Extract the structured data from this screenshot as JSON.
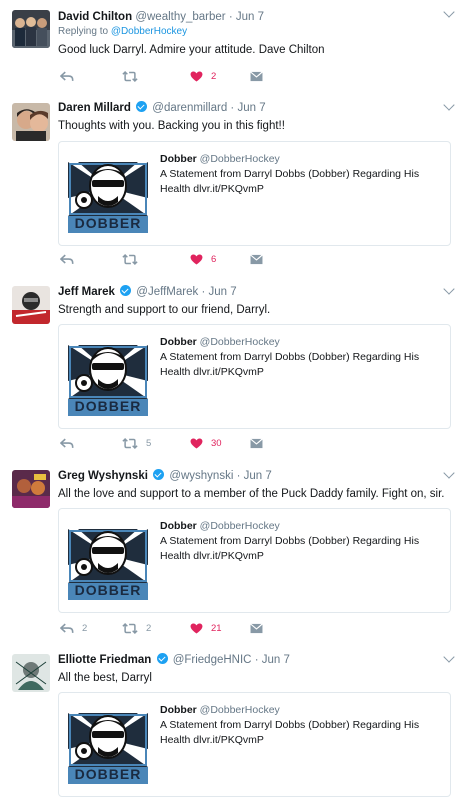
{
  "colors": {
    "link": "#1b95e0",
    "verified": "#1da1f2",
    "like_active": "#e0245e",
    "icon": "#8899a6",
    "divider": "#e6ecf0"
  },
  "icons": {
    "reply": "reply-arrow-icon",
    "retweet": "retweet-icon",
    "like": "heart-icon",
    "dm": "envelope-icon",
    "menu": "chevron-down-icon",
    "verified": "verified-badge-icon"
  },
  "tweets": [
    {
      "name": "David Chilton",
      "handle": "@wealthy_barber",
      "dot": "·",
      "date": "Jun 7",
      "verified": false,
      "replying_prefix": "Replying to",
      "replying_handle": "@DobberHockey",
      "text": "Good luck Darryl. Admire your attitude. Dave Chilton",
      "reply_count": "",
      "retweet_count": "",
      "like_count": "2"
    },
    {
      "name": "Daren Millard",
      "handle": "@darenmillard",
      "dot": "·",
      "date": "Jun 7",
      "verified": true,
      "text": "Thoughts with you. Backing you in this fight!!",
      "card": {
        "title_name": "Dobber",
        "title_handle": "@DobberHockey",
        "description": "A Statement from Darryl Dobbs (Dobber) Regarding His Health dlvr.it/PKQvmP",
        "logo_text": "DOBBER"
      },
      "reply_count": "",
      "retweet_count": "",
      "like_count": "6"
    },
    {
      "name": "Jeff Marek",
      "handle": "@JeffMarek",
      "dot": "·",
      "date": "Jun 7",
      "verified": true,
      "text": "Strength and support to our friend, Darryl.",
      "card": {
        "title_name": "Dobber",
        "title_handle": "@DobberHockey",
        "description": "A Statement from Darryl Dobbs (Dobber) Regarding His Health dlvr.it/PKQvmP",
        "logo_text": "DOBBER"
      },
      "reply_count": "",
      "retweet_count": "5",
      "like_count": "30"
    },
    {
      "name": "Greg Wyshynski",
      "handle": "@wyshynski",
      "dot": "·",
      "date": "Jun 7",
      "verified": true,
      "text": "All the love and support to a member of the Puck Daddy family. Fight on, sir.",
      "card": {
        "title_name": "Dobber",
        "title_handle": "@DobberHockey",
        "description": "A Statement from Darryl Dobbs (Dobber) Regarding His Health dlvr.it/PKQvmP",
        "logo_text": "DOBBER"
      },
      "reply_count": "2",
      "retweet_count": "2",
      "like_count": "21"
    },
    {
      "name": "Elliotte Friedman",
      "handle": "@FriedgeHNIC",
      "dot": "·",
      "date": "Jun 7",
      "verified": true,
      "text": "All the best, Darryl",
      "card": {
        "title_name": "Dobber",
        "title_handle": "@DobberHockey",
        "description": "A Statement from Darryl Dobbs (Dobber) Regarding His Health dlvr.it/PKQvmP",
        "logo_text": "DOBBER"
      }
    }
  ]
}
